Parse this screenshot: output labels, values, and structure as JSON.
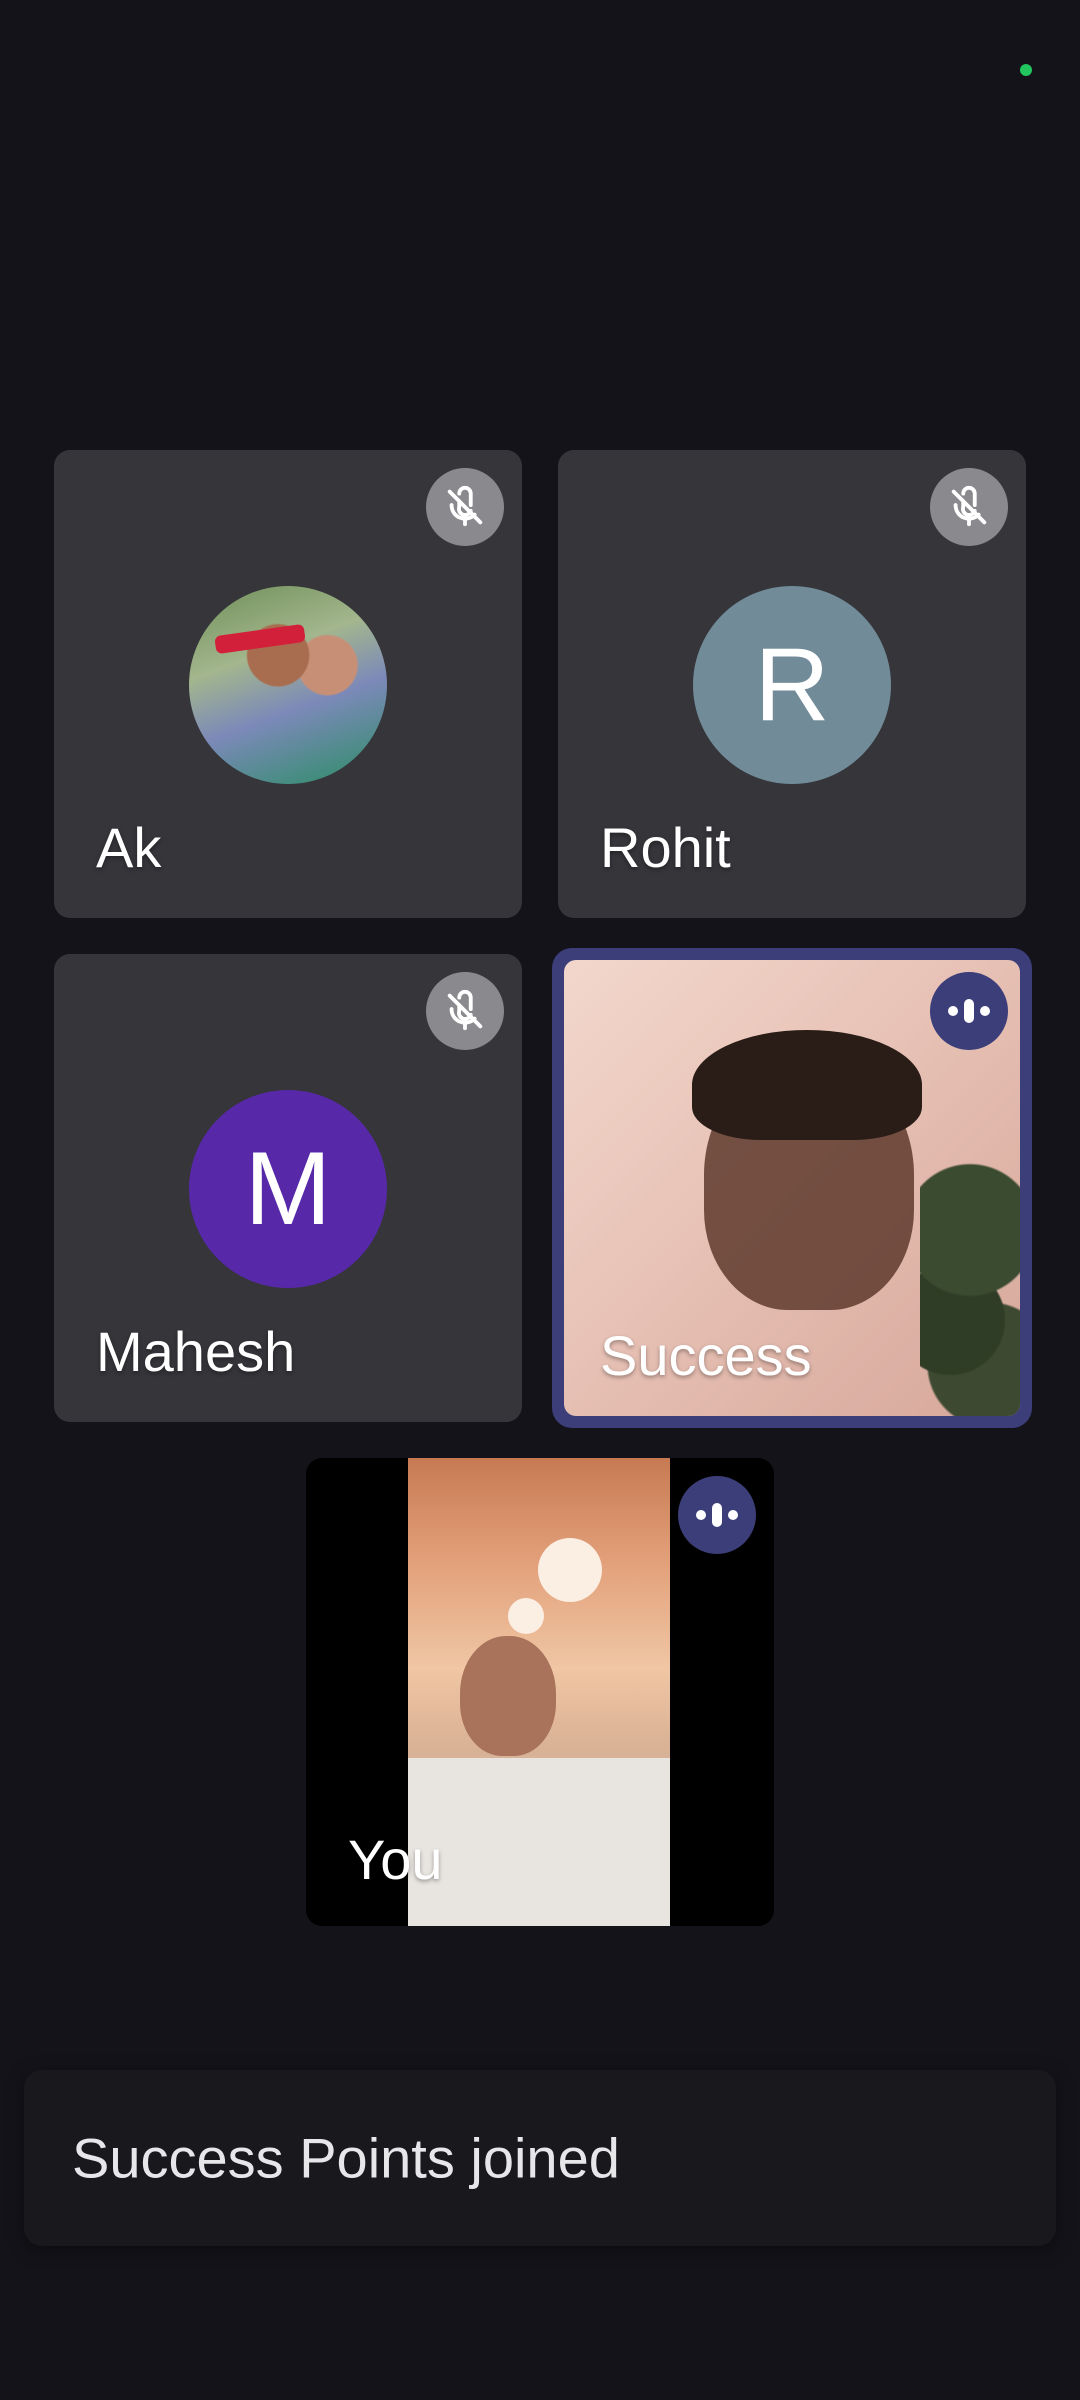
{
  "status": {
    "indicator": "green-dot",
    "color": "#22c55e"
  },
  "participants": [
    {
      "name": "Ak",
      "avatar": "photo",
      "muted": true,
      "mute_icon": "mic-off-icon"
    },
    {
      "name": "Rohit",
      "initial": "R",
      "avatar_color": "#718b98",
      "muted": true,
      "mute_icon": "mic-off-icon"
    },
    {
      "name": "Mahesh",
      "initial": "M",
      "avatar_color": "#5729a8",
      "muted": true,
      "mute_icon": "mic-off-icon"
    },
    {
      "name": "Success",
      "video": true,
      "speaking": true,
      "speaking_icon": "audio-level-icon",
      "highlight_color": "#3c3e7a"
    },
    {
      "name": "You",
      "video": true,
      "speaking": true,
      "speaking_icon": "audio-level-icon"
    }
  ],
  "toast": {
    "message": "Success Points joined"
  }
}
